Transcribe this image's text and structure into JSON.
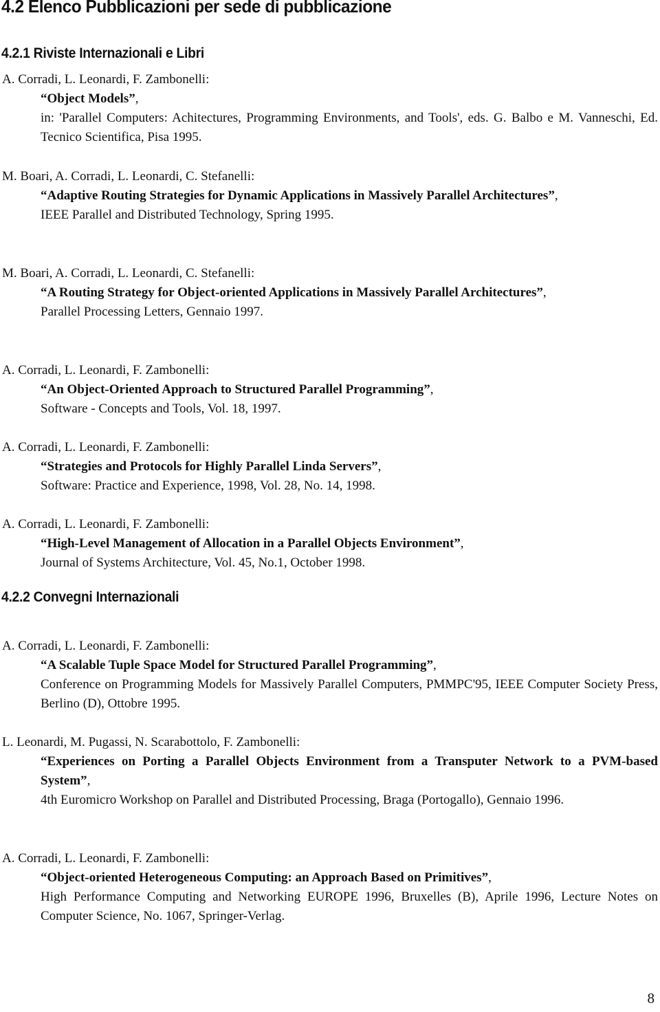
{
  "heading": "4.2 Elenco Pubblicazioni per sede di pubblicazione",
  "sections": [
    {
      "title": "4.2.1 Riviste Internazionali e Libri",
      "entries": [
        {
          "authors": "A. Corradi, L. Leonardi, F. Zambonelli:",
          "title": "“Object Models”",
          "venue": "in: 'Parallel Computers: Achitectures, Programming Environments, and Tools', eds. G. Balbo e M. Vanneschi, Ed. Tecnico Scientifica, Pisa 1995."
        },
        {
          "authors": "M. Boari, A. Corradi, L. Leonardi, C. Stefanelli:",
          "title": "“Adaptive Routing Strategies for Dynamic Applications in Massively Parallel Architectures”",
          "venue": "IEEE Parallel and Distributed Technology, Spring 1995."
        },
        {
          "authors": "M. Boari, A. Corradi, L. Leonardi, C. Stefanelli:",
          "title": "“A Routing Strategy for Object-oriented Applications in Massively Parallel Architectures”",
          "venue": "Parallel Processing Letters, Gennaio 1997."
        },
        {
          "authors": "A. Corradi, L. Leonardi, F. Zambonelli:",
          "title": "“An Object-Oriented Approach to Structured Parallel Programming”",
          "venue": "Software - Concepts and Tools, Vol. 18, 1997."
        },
        {
          "authors": "A. Corradi, L. Leonardi, F. Zambonelli:",
          "title": "“Strategies and Protocols for Highly Parallel Linda Servers”",
          "venue": "Software: Practice and Experience, 1998, Vol. 28, No. 14, 1998."
        },
        {
          "authors": "A. Corradi, L. Leonardi, F. Zambonelli:",
          "title": "“High-Level Management of Allocation in a Parallel Objects Environment”",
          "venue": "Journal of Systems Architecture, Vol. 45, No.1, October 1998."
        }
      ]
    },
    {
      "title": "4.2.2 Convegni Internazionali",
      "entries": [
        {
          "authors": "A. Corradi, L. Leonardi, F. Zambonelli:",
          "title": "“A Scalable Tuple Space Model for Structured Parallel Programming”",
          "venue": "Conference on Programming Models for Massively Parallel Computers, PMMPC'95, IEEE Computer Society Press, Berlino (D), Ottobre 1995."
        },
        {
          "authors": "L. Leonardi, M. Pugassi, N. Scarabottolo, F. Zambonelli:",
          "title": "“Experiences on Porting a Parallel Objects Environment from a Transputer Network to a PVM-based System”",
          "venue": "4th Euromicro Workshop on Parallel and Distributed Processing, Braga (Portogallo), Gennaio 1996."
        },
        {
          "authors": "A. Corradi, L. Leonardi, F. Zambonelli:",
          "title": "“Object-oriented Heterogeneous Computing: an Approach Based on Primitives”",
          "venue": "High Performance Computing and Networking EUROPE 1996, Bruxelles (B), Aprile 1996, Lecture Notes on Computer Science, No. 1067, Springer-Verlag."
        }
      ]
    }
  ],
  "title_suffix": ",",
  "page_number": "8"
}
